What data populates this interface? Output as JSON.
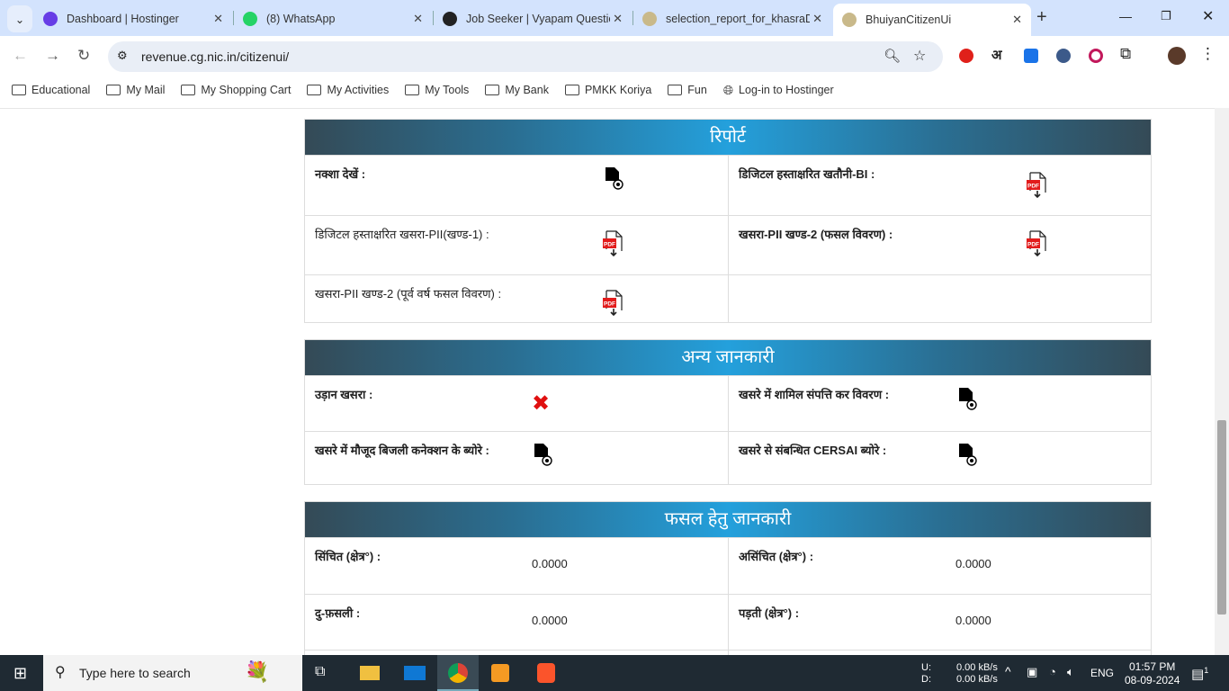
{
  "browser": {
    "tabs": [
      {
        "title": "Dashboard | Hostinger",
        "color": "#673de6"
      },
      {
        "title": "(8) WhatsApp",
        "color": "#25d366"
      },
      {
        "title": "Job Seeker | Vyapam Questio",
        "color": "#222"
      },
      {
        "title": "selection_report_for_khasraD",
        "color": "#c9b98a"
      },
      {
        "title": "BhuiyanCitizenUi",
        "color": "#c9b98a",
        "active": true
      }
    ],
    "url": "revenue.cg.nic.in/citizenui/",
    "bookmarks": [
      "Educational",
      "My Mail",
      "My Shopping Cart",
      "My Activities",
      "My Tools",
      "My Bank",
      "PMKK Koriya",
      "Fun",
      "Log-in to Hostinger"
    ],
    "ext_letter": "अ"
  },
  "sections": [
    {
      "title": "रिपोर्ट",
      "rows": [
        [
          {
            "label": "नक्शा देखें :",
            "bold": true,
            "icon": "view"
          },
          {
            "label": "डिजिटल हस्ताक्षरित खतौनी-BI :",
            "bold": true,
            "icon": "pdf"
          }
        ],
        [
          {
            "label": "डिजिटल हस्ताक्षरित खसरा-PII(खण्ड-1) :",
            "icon": "pdf"
          },
          {
            "label": "खसरा-PII खण्ड-2 (फसल विवरण) :",
            "bold": true,
            "icon": "pdf"
          }
        ],
        [
          {
            "label": "खसरा-PII खण्ड-2 (पूर्व वर्ष फसल विवरण) :",
            "icon": "pdf"
          },
          {}
        ]
      ]
    },
    {
      "title": "अन्य जानकारी",
      "rows": [
        [
          {
            "label": "उड़ान खसरा :",
            "bold": true,
            "icon": "cross"
          },
          {
            "label": "खसरे में शामिल संपत्ति कर विवरण :",
            "bold": true,
            "icon": "view"
          }
        ],
        [
          {
            "label": "खसरे में मौजूद बिजली कनेक्शन के ब्योरे :",
            "bold": true,
            "icon": "view"
          },
          {
            "label": "खसरे से संबन्धित CERSAI ब्योरे :",
            "bold": true,
            "icon": "view"
          }
        ]
      ]
    },
    {
      "title": "फसल हेतु जानकारी",
      "rows": [
        [
          {
            "label": "सिंचित (क्षेत्र°) :",
            "bold": true,
            "value": "0.0000"
          },
          {
            "label": "असिंचित (क्षेत्र°) :",
            "bold": true,
            "value": "0.0000"
          }
        ],
        [
          {
            "label": "दु-फ़सली :",
            "bold": true,
            "value": "0.0000"
          },
          {
            "label": "पड़ती (क्षेत्र°) :",
            "bold": true,
            "value": "0.0000"
          }
        ],
        [
          {},
          {}
        ]
      ]
    }
  ],
  "taskbar": {
    "search_placeholder": "Type here to search",
    "net_up_label": "U:",
    "net_down_label": "D:",
    "net_up": "0.00 kB/s",
    "net_down": "0.00 kB/s",
    "lang": "ENG",
    "time": "01:57 PM",
    "date": "08-09-2024",
    "notifications": "1"
  }
}
